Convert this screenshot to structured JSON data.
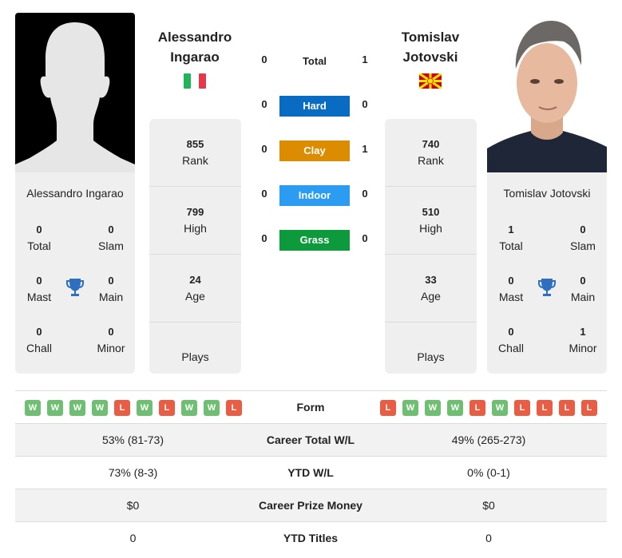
{
  "player1": {
    "name_line1": "Alessandro",
    "name_line2": "Ingarao",
    "full_name": "Alessandro Ingarao",
    "country_flag": "italy-flag",
    "photo": "silhouette-placeholder",
    "rank": "855",
    "rank_label": "Rank",
    "high": "799",
    "high_label": "High",
    "age": "24",
    "age_label": "Age",
    "plays_label": "Plays",
    "titles": {
      "total": "0",
      "total_label": "Total",
      "slam": "0",
      "slam_label": "Slam",
      "mast": "0",
      "mast_label": "Mast",
      "main": "0",
      "main_label": "Main",
      "chall": "0",
      "chall_label": "Chall",
      "minor": "0",
      "minor_label": "Minor"
    }
  },
  "player2": {
    "name_line1": "Tomislav",
    "name_line2": "Jotovski",
    "full_name": "Tomislav Jotovski",
    "country_flag": "north-macedonia-flag",
    "photo": "player-headshot",
    "rank": "740",
    "rank_label": "Rank",
    "high": "510",
    "high_label": "High",
    "age": "33",
    "age_label": "Age",
    "plays_label": "Plays",
    "titles": {
      "total": "1",
      "total_label": "Total",
      "slam": "0",
      "slam_label": "Slam",
      "mast": "0",
      "mast_label": "Mast",
      "main": "0",
      "main_label": "Main",
      "chall": "0",
      "chall_label": "Chall",
      "minor": "1",
      "minor_label": "Minor"
    }
  },
  "h2h": {
    "total": {
      "label": "Total",
      "p1": "0",
      "p2": "1"
    },
    "surfaces": [
      {
        "label": "Hard",
        "p1": "0",
        "p2": "0",
        "color": "#0a6bc2"
      },
      {
        "label": "Clay",
        "p1": "0",
        "p2": "1",
        "color": "#dc8c00"
      },
      {
        "label": "Indoor",
        "p1": "0",
        "p2": "0",
        "color": "#2b9cf2"
      },
      {
        "label": "Grass",
        "p1": "0",
        "p2": "0",
        "color": "#0c9a3c"
      }
    ]
  },
  "comparison": {
    "form_label": "Form",
    "p1_form": [
      "W",
      "W",
      "W",
      "W",
      "L",
      "W",
      "L",
      "W",
      "W",
      "L"
    ],
    "p2_form": [
      "L",
      "W",
      "W",
      "W",
      "L",
      "W",
      "L",
      "L",
      "L",
      "L"
    ],
    "rows": [
      {
        "label": "Career Total W/L",
        "p1": "53% (81-73)",
        "p2": "49% (265-273)"
      },
      {
        "label": "YTD W/L",
        "p1": "73% (8-3)",
        "p2": "0% (0-1)"
      },
      {
        "label": "Career Prize Money",
        "p1": "$0",
        "p2": "$0"
      },
      {
        "label": "YTD Titles",
        "p1": "0",
        "p2": "0"
      }
    ]
  },
  "colors": {
    "win": "#6fbf73",
    "loss": "#ea5d45",
    "trophy": "#2f6fbf"
  }
}
